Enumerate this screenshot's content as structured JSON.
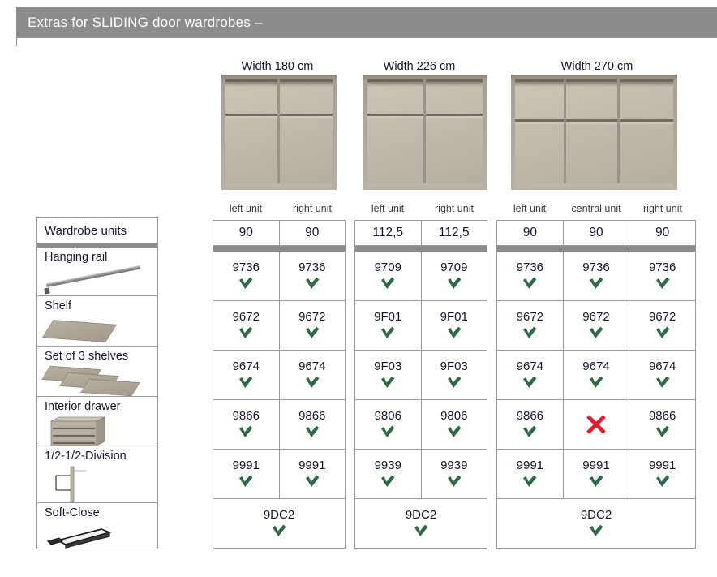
{
  "header": {
    "title": "Extras for SLIDING door wardrobes –",
    "bg_color": "#8c8c8c"
  },
  "colors": {
    "tick_green": "#2f6a46",
    "cross_red": "#e8192c",
    "grid_line": "#9a9a9a",
    "separator": "#8c8c8c",
    "text_dark": "#15152e"
  },
  "legend": {
    "header": "Wardrobe units",
    "items": [
      {
        "label": "Hanging rail",
        "icon": "hanging-rail-icon"
      },
      {
        "label": "Shelf",
        "icon": "shelf-icon"
      },
      {
        "label": "Set of 3 shelves",
        "icon": "three-shelves-icon"
      },
      {
        "label": "Interior drawer",
        "icon": "interior-drawer-icon"
      },
      {
        "label": "1/2-1/2-Division",
        "icon": "half-division-icon"
      },
      {
        "label": "Soft-Close",
        "icon": "soft-close-icon"
      }
    ]
  },
  "groups": [
    {
      "caption": "Width 180 cm",
      "image": "wardrobe-180-2-section",
      "sections": 2,
      "units": [
        {
          "name": "left unit",
          "width": "90"
        },
        {
          "name": "right unit",
          "width": "90"
        }
      ],
      "rows": [
        {
          "feature": "Hanging rail",
          "cells": [
            {
              "code": "9736",
              "mark": "check"
            },
            {
              "code": "9736",
              "mark": "check"
            }
          ]
        },
        {
          "feature": "Shelf",
          "cells": [
            {
              "code": "9672",
              "mark": "check"
            },
            {
              "code": "9672",
              "mark": "check"
            }
          ]
        },
        {
          "feature": "Set of 3 shelves",
          "cells": [
            {
              "code": "9674",
              "mark": "check"
            },
            {
              "code": "9674",
              "mark": "check"
            }
          ]
        },
        {
          "feature": "Interior drawer",
          "cells": [
            {
              "code": "9866",
              "mark": "check"
            },
            {
              "code": "9866",
              "mark": "check"
            }
          ]
        },
        {
          "feature": "1/2-1/2-Division",
          "cells": [
            {
              "code": "9991",
              "mark": "check"
            },
            {
              "code": "9991",
              "mark": "check"
            }
          ]
        }
      ],
      "soft_close": {
        "code": "9DC2",
        "mark": "check"
      }
    },
    {
      "caption": "Width 226 cm",
      "image": "wardrobe-226-2-section",
      "sections": 2,
      "units": [
        {
          "name": "left unit",
          "width": "112,5"
        },
        {
          "name": "right unit",
          "width": "112,5"
        }
      ],
      "rows": [
        {
          "feature": "Hanging rail",
          "cells": [
            {
              "code": "9709",
              "mark": "check"
            },
            {
              "code": "9709",
              "mark": "check"
            }
          ]
        },
        {
          "feature": "Shelf",
          "cells": [
            {
              "code": "9F01",
              "mark": "check"
            },
            {
              "code": "9F01",
              "mark": "check"
            }
          ]
        },
        {
          "feature": "Set of 3 shelves",
          "cells": [
            {
              "code": "9F03",
              "mark": "check"
            },
            {
              "code": "9F03",
              "mark": "check"
            }
          ]
        },
        {
          "feature": "Interior drawer",
          "cells": [
            {
              "code": "9806",
              "mark": "check"
            },
            {
              "code": "9806",
              "mark": "check"
            }
          ]
        },
        {
          "feature": "1/2-1/2-Division",
          "cells": [
            {
              "code": "9939",
              "mark": "check"
            },
            {
              "code": "9939",
              "mark": "check"
            }
          ]
        }
      ],
      "soft_close": {
        "code": "9DC2",
        "mark": "check"
      }
    },
    {
      "caption": "Width 270 cm",
      "image": "wardrobe-270-3-section",
      "sections": 3,
      "units": [
        {
          "name": "left unit",
          "width": "90"
        },
        {
          "name": "central unit",
          "width": "90"
        },
        {
          "name": "right unit",
          "width": "90"
        }
      ],
      "rows": [
        {
          "feature": "Hanging rail",
          "cells": [
            {
              "code": "9736",
              "mark": "check"
            },
            {
              "code": "9736",
              "mark": "check"
            },
            {
              "code": "9736",
              "mark": "check"
            }
          ]
        },
        {
          "feature": "Shelf",
          "cells": [
            {
              "code": "9672",
              "mark": "check"
            },
            {
              "code": "9672",
              "mark": "check"
            },
            {
              "code": "9672",
              "mark": "check"
            }
          ]
        },
        {
          "feature": "Set of 3 shelves",
          "cells": [
            {
              "code": "9674",
              "mark": "check"
            },
            {
              "code": "9674",
              "mark": "check"
            },
            {
              "code": "9674",
              "mark": "check"
            }
          ]
        },
        {
          "feature": "Interior drawer",
          "cells": [
            {
              "code": "9866",
              "mark": "check"
            },
            {
              "code": "",
              "mark": "cross"
            },
            {
              "code": "9866",
              "mark": "check"
            }
          ]
        },
        {
          "feature": "1/2-1/2-Division",
          "cells": [
            {
              "code": "9991",
              "mark": "check"
            },
            {
              "code": "9991",
              "mark": "check"
            },
            {
              "code": "9991",
              "mark": "check"
            }
          ]
        }
      ],
      "soft_close": {
        "code": "9DC2",
        "mark": "check"
      }
    }
  ]
}
